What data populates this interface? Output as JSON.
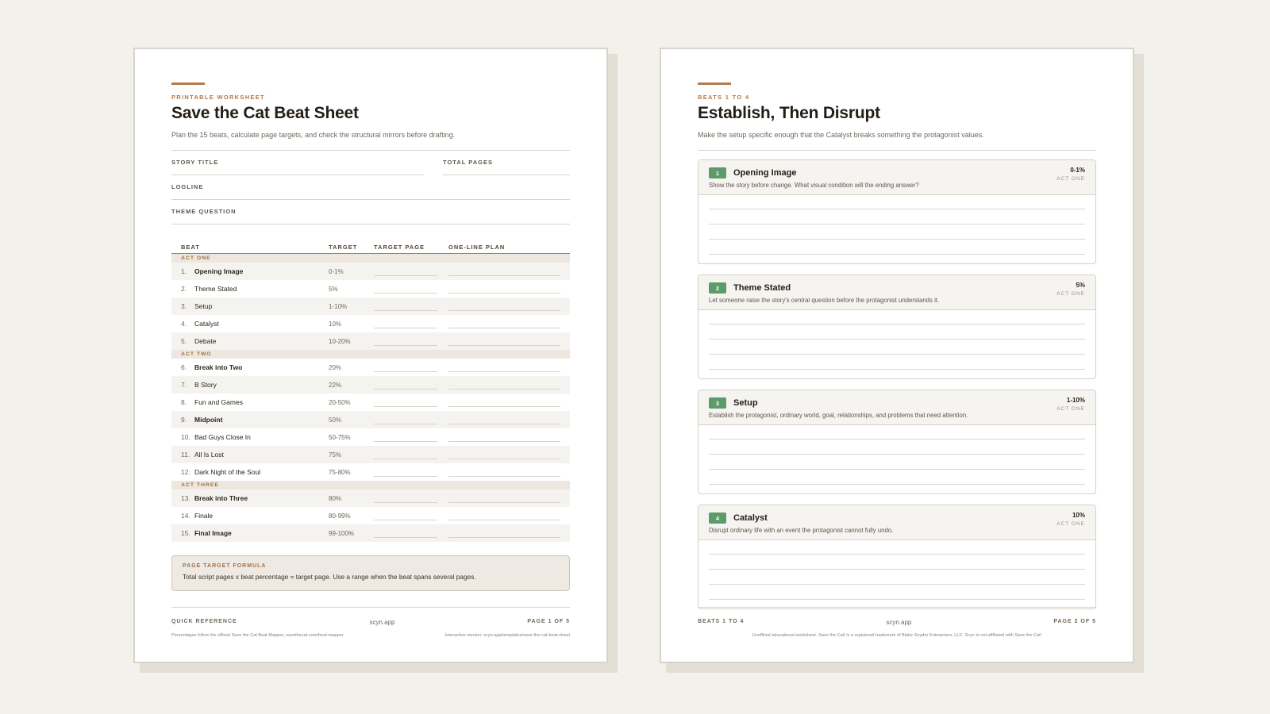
{
  "page1": {
    "eyebrow": "PRINTABLE WORKSHEET",
    "title": "Save the Cat Beat Sheet",
    "subtitle": "Plan the 15 beats, calculate page targets, and check the structural mirrors before drafting.",
    "fields": {
      "story_title": "STORY TITLE",
      "total_pages": "TOTAL PAGES",
      "logline": "LOGLINE",
      "theme_question": "THEME QUESTION"
    },
    "table_headers": {
      "beat": "BEAT",
      "target": "TARGET",
      "target_page": "TARGET PAGE",
      "plan": "ONE-LINE PLAN"
    },
    "acts": [
      {
        "label": "ACT ONE",
        "beats": [
          {
            "num": "1.",
            "name": "Opening Image",
            "target": "0-1%",
            "key": true
          },
          {
            "num": "2.",
            "name": "Theme Stated",
            "target": "5%",
            "key": false
          },
          {
            "num": "3.",
            "name": "Setup",
            "target": "1-10%",
            "key": false
          },
          {
            "num": "4.",
            "name": "Catalyst",
            "target": "10%",
            "key": false
          },
          {
            "num": "5.",
            "name": "Debate",
            "target": "10-20%",
            "key": false
          }
        ]
      },
      {
        "label": "ACT TWO",
        "beats": [
          {
            "num": "6.",
            "name": "Break into Two",
            "target": "20%",
            "key": true
          },
          {
            "num": "7.",
            "name": "B Story",
            "target": "22%",
            "key": false
          },
          {
            "num": "8.",
            "name": "Fun and Games",
            "target": "20-50%",
            "key": false
          },
          {
            "num": "9.",
            "name": "Midpoint",
            "target": "50%",
            "key": true
          },
          {
            "num": "10.",
            "name": "Bad Guys Close In",
            "target": "50-75%",
            "key": false
          },
          {
            "num": "11.",
            "name": "All Is Lost",
            "target": "75%",
            "key": false
          },
          {
            "num": "12.",
            "name": "Dark Night of the Soul",
            "target": "75-80%",
            "key": false
          }
        ]
      },
      {
        "label": "ACT THREE",
        "beats": [
          {
            "num": "13.",
            "name": "Break into Three",
            "target": "80%",
            "key": true
          },
          {
            "num": "14.",
            "name": "Finale",
            "target": "80-99%",
            "key": false
          },
          {
            "num": "15.",
            "name": "Final Image",
            "target": "99-100%",
            "key": true
          }
        ]
      }
    ],
    "formula": {
      "label": "PAGE TARGET FORMULA",
      "text": "Total script pages x beat percentage = target page. Use a range when the beat spans several pages."
    },
    "footer": {
      "left": "QUICK REFERENCE",
      "center": "scyn.app",
      "right": "PAGE 1 OF 5",
      "fine_left": "Percentages follow the official Save the Cat Beat Mapper, savethecat.com/beat-mapper",
      "fine_right": "Interactive version: scyn.app/templates/save-the-cat-beat-sheet"
    }
  },
  "page2": {
    "eyebrow": "BEATS 1 TO 4",
    "title": "Establish, Then Disrupt",
    "subtitle": "Make the setup specific enough that the Catalyst breaks something the protagonist values.",
    "cards": [
      {
        "num": "1",
        "title": "Opening Image",
        "pct": "0-1%",
        "act": "ACT ONE",
        "prompt": "Show the story before change. What visual condition will the ending answer?"
      },
      {
        "num": "2",
        "title": "Theme Stated",
        "pct": "5%",
        "act": "ACT ONE",
        "prompt": "Let someone raise the story's central question before the protagonist understands it."
      },
      {
        "num": "3",
        "title": "Setup",
        "pct": "1-10%",
        "act": "ACT ONE",
        "prompt": "Establish the protagonist, ordinary world, goal, relationships, and problems that need attention."
      },
      {
        "num": "4",
        "title": "Catalyst",
        "pct": "10%",
        "act": "ACT ONE",
        "prompt": "Disrupt ordinary life with an event the protagonist cannot fully undo."
      }
    ],
    "footer": {
      "left": "BEATS 1 TO 4",
      "center": "scyn.app",
      "right": "PAGE 2 OF 5",
      "fine": "Unofficial educational worksheet. Save the Cat! is a registered trademark of Blake Snyder Enterprises, LLC. Scyn is not affiliated with Save the Cat!"
    }
  }
}
